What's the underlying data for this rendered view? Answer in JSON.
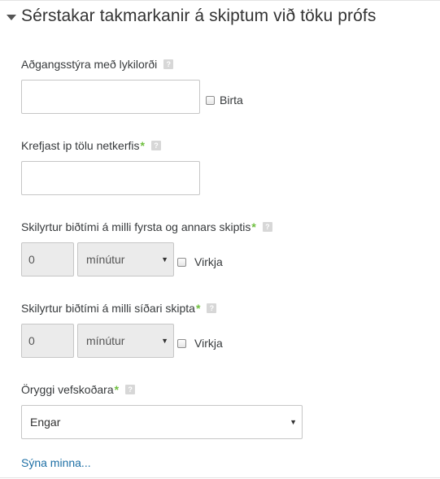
{
  "section": {
    "title": "Sérstakar takmarkanir á skiptum við töku prófs"
  },
  "password": {
    "label": "Aðgangsstýra með lykilorði",
    "value": "",
    "reveal_label": "Birta"
  },
  "subnet": {
    "label": "Krefjast ip tölu netkerfis",
    "required_mark": "*",
    "value": ""
  },
  "delay1": {
    "label": "Skilyrtur biðtími á milli fyrsta og annars skiptis",
    "required_mark": "*",
    "value": "0",
    "unit": "mínútur",
    "enable_label": "Virkja"
  },
  "delay2": {
    "label": "Skilyrtur biðtími á milli síðari skipta",
    "required_mark": "*",
    "value": "0",
    "unit": "mínútur",
    "enable_label": "Virkja"
  },
  "browser_security": {
    "label": "Öryggi vefskoðara",
    "required_mark": "*",
    "value": "Engar"
  },
  "show_less": "Sýna minna...",
  "help_glyph": "?",
  "colors": {
    "required": "#6fbf3f",
    "link": "#1d6fa5",
    "disabled_bg": "#ebebeb",
    "border": "#c6c6c6"
  }
}
